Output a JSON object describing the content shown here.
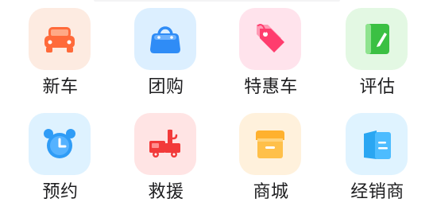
{
  "menu": {
    "row1": [
      {
        "label": "新车",
        "icon": "car-icon",
        "bg": "#fdebe1",
        "color": "#ff6a3a"
      },
      {
        "label": "团购",
        "icon": "shopping-bag-icon",
        "bg": "#dcefff",
        "color": "#2f8cf6"
      },
      {
        "label": "特惠车",
        "icon": "price-tag-icon",
        "bg": "#ffe3ec",
        "color": "#ff3d6e"
      },
      {
        "label": "评估",
        "icon": "edit-document-icon",
        "bg": "#e3f8e3",
        "color": "#3bc043"
      }
    ],
    "row2": [
      {
        "label": "预约",
        "icon": "alarm-clock-icon",
        "bg": "#def2ff",
        "color": "#2f9cf6"
      },
      {
        "label": "救援",
        "icon": "tow-truck-icon",
        "bg": "#ffe4e4",
        "color": "#f23a3a"
      },
      {
        "label": "商城",
        "icon": "store-icon",
        "bg": "#fff1dc",
        "color": "#ffb12e"
      },
      {
        "label": "经销商",
        "icon": "dealer-icon",
        "bg": "#dff3ff",
        "color": "#2aa6f2"
      }
    ]
  }
}
